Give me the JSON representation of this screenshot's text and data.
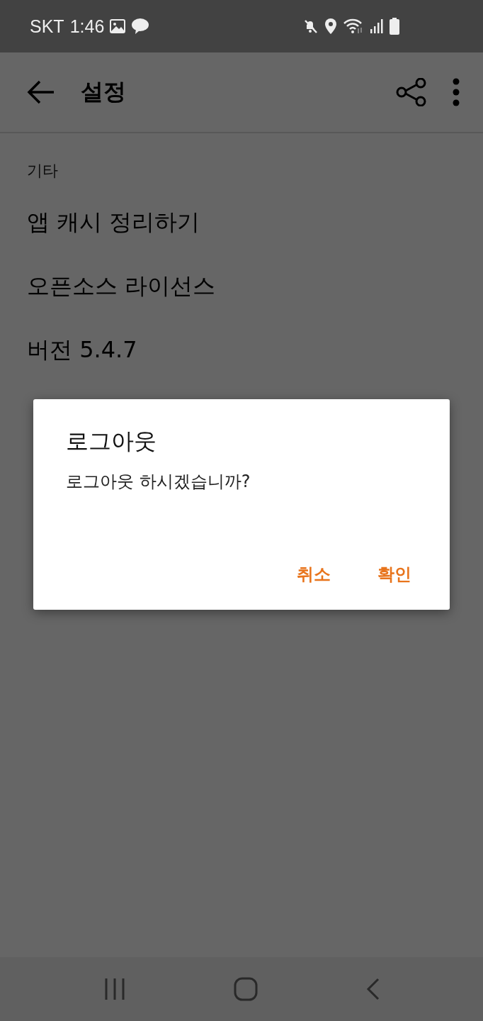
{
  "status_bar": {
    "carrier": "SKT",
    "time": "1:46"
  },
  "app_bar": {
    "title": "설정"
  },
  "section": {
    "header": "기타",
    "items": [
      "앱 캐시 정리하기",
      "오픈소스 라이선스",
      "버전 5.4.7"
    ]
  },
  "dialog": {
    "title": "로그아웃",
    "message": "로그아웃 하시겠습니까?",
    "buttons": [
      "취소",
      "확인"
    ]
  }
}
